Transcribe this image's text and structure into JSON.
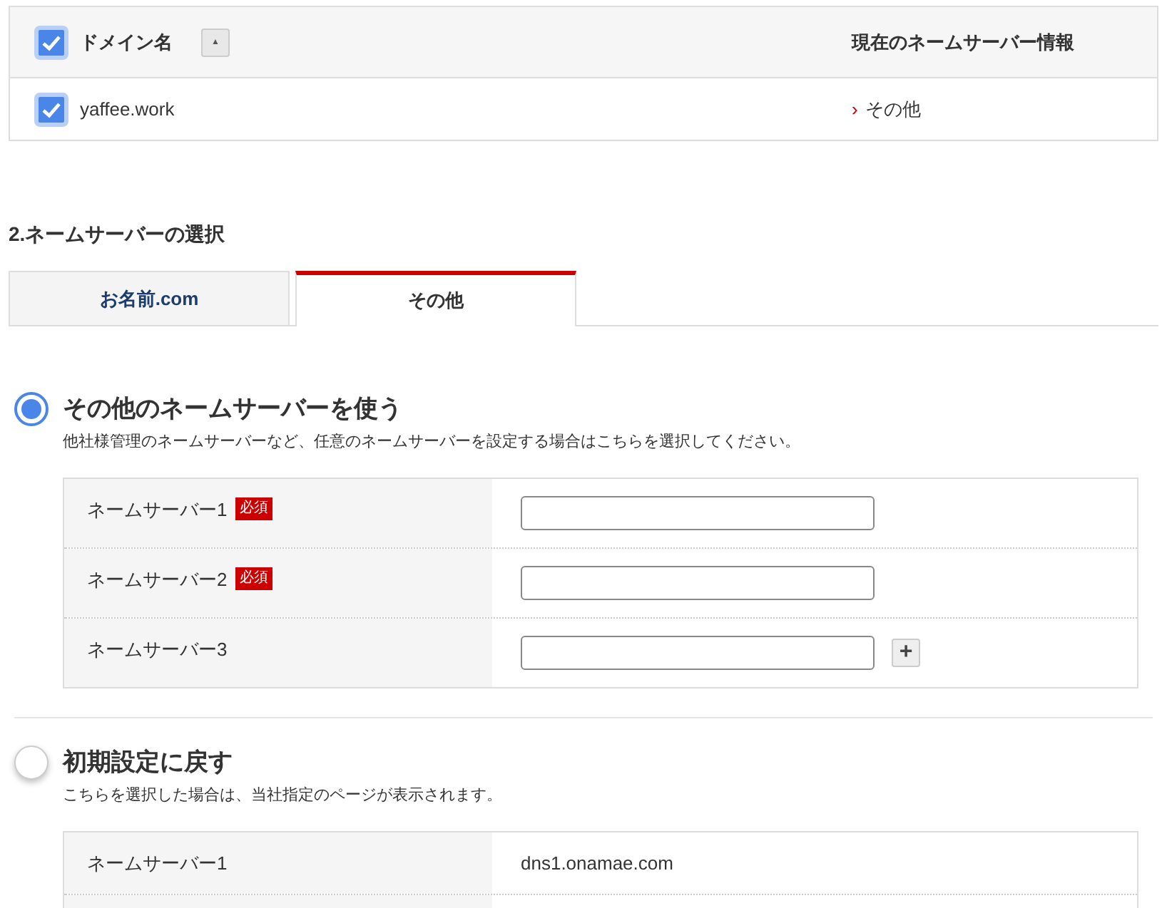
{
  "domain_table": {
    "select_all_checked": true,
    "columns": [
      {
        "label": "ドメイン名",
        "sort_button": "▲"
      },
      {
        "label": "現在のネームサーバー情報"
      }
    ],
    "rows": [
      {
        "checked": true,
        "domain": "yaffee.work",
        "current_nameserver": "その他",
        "marker": "›"
      }
    ]
  },
  "section_title": "2.ネームサーバーの選択",
  "tabs": [
    {
      "label": "お名前.com",
      "selected": false
    },
    {
      "label": "その他",
      "selected": true
    }
  ],
  "options": [
    {
      "title": "その他のネームサーバーを使う",
      "description": "他社様管理のネームサーバーなど、任意のネームサーバーを設定する場合はこちらを選択してください。",
      "selected": true,
      "rows": [
        {
          "kind": "input",
          "label": "ネームサーバー1",
          "badge": "必須"
        },
        {
          "kind": "input",
          "label": "ネームサーバー2",
          "badge": "必須"
        },
        {
          "kind": "input",
          "label": "ネームサーバー3",
          "add_button": "+"
        }
      ]
    },
    {
      "title": "初期設定に戻す",
      "description": "こちらを選択した場合は、当社指定のページが表示されます。",
      "selected": false,
      "rows": [
        {
          "kind": "text",
          "label": "ネームサーバー1",
          "value": "dns1.onamae.com"
        },
        {
          "kind": "text"
        }
      ]
    }
  ]
}
